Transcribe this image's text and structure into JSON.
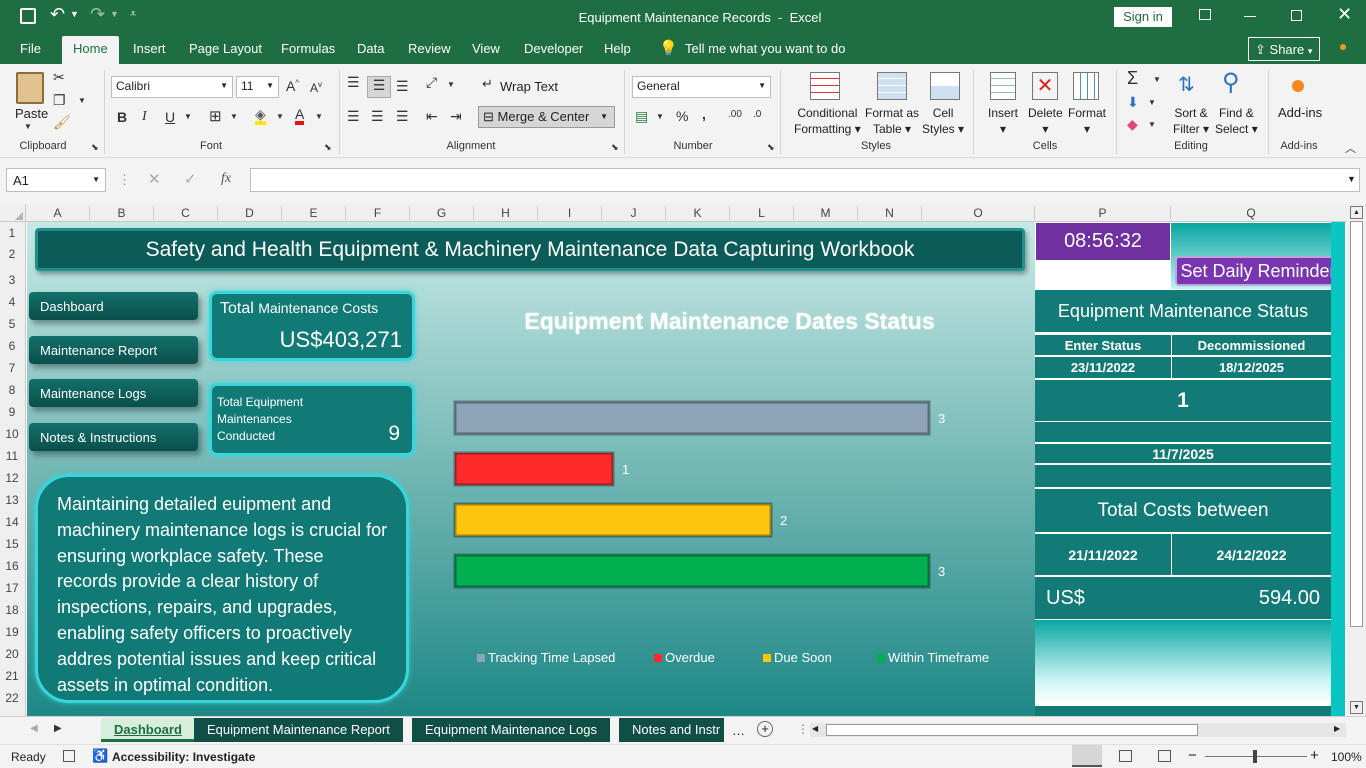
{
  "titlebar": {
    "doc_title": "Equipment Maintenance Records  -  Excel",
    "sign_in": "Sign in"
  },
  "menu": {
    "items": [
      "File",
      "Home",
      "Insert",
      "Page Layout",
      "Formulas",
      "Data",
      "Review",
      "View",
      "Developer",
      "Help"
    ],
    "tell_me": "Tell me what you want to do",
    "share": "Share"
  },
  "ribbon": {
    "clipboard": {
      "paste": "Paste",
      "label": "Clipboard"
    },
    "font": {
      "name": "Calibri",
      "size": "11",
      "label": "Font"
    },
    "alignment": {
      "wrap": "Wrap Text",
      "merge": "Merge & Center",
      "label": "Alignment"
    },
    "number": {
      "format": "General",
      "label": "Number"
    },
    "styles": {
      "cond1": "Conditional",
      "cond2": "Formatting",
      "fmt1": "Format as",
      "fmt2": "Table",
      "cell1": "Cell",
      "cell2": "Styles",
      "label": "Styles"
    },
    "cells": {
      "insert": "Insert",
      "delete": "Delete",
      "format": "Format",
      "label": "Cells"
    },
    "editing": {
      "sort1": "Sort &",
      "sort2": "Filter",
      "find1": "Find &",
      "find2": "Select",
      "label": "Editing"
    },
    "addins": {
      "btn": "Add-ins",
      "label": "Add-ins"
    }
  },
  "formula_bar": {
    "name_box": "A1",
    "fx": "fx",
    "formula": ""
  },
  "columns": [
    "A",
    "B",
    "C",
    "D",
    "E",
    "F",
    "G",
    "H",
    "I",
    "J",
    "K",
    "L",
    "M",
    "N",
    "O",
    "P",
    "Q"
  ],
  "rows": [
    "1",
    "2",
    "3",
    "4",
    "5",
    "6",
    "7",
    "8",
    "9",
    "10",
    "11",
    "12",
    "13",
    "14",
    "15",
    "16",
    "17",
    "18",
    "19",
    "20",
    "21",
    "22"
  ],
  "dashboard": {
    "banner": "Safety and Health Equipment & Machinery Maintenance Data Capturing Workbook",
    "nav": [
      "Dashboard",
      "Maintenance Report",
      "Maintenance Logs",
      "Notes & Instructions"
    ],
    "total_costs_label": "Total",
    "total_costs_label2": "Maintenance Costs",
    "total_costs_value": "US$403,271",
    "equip_label1": "Total Equipment",
    "equip_label2": "Maintenances",
    "equip_label3": "Conducted",
    "equip_value": "9",
    "note": "Maintaining detailed euipment and machinery maintenance logs is crucial for ensuring workplace safety. These records provide a clear history of inspections, repairs, and upgrades, enabling safety officers to proactively addres potential issues and keep critical assets in optimal condition."
  },
  "chart_data": {
    "type": "bar",
    "title": "Equipment Maintenance Dates Status",
    "categories": [
      "Tracking Time Lapsed",
      "Overdue",
      "Due Soon",
      "Within Timeframe"
    ],
    "values": [
      3,
      1,
      2,
      3
    ],
    "colors": [
      "#8da3b8",
      "#ff2a2a",
      "#ffc50c",
      "#00b050"
    ],
    "data_labels": [
      "3",
      "1",
      "2",
      "3"
    ],
    "xlim": [
      0,
      3
    ],
    "legend": "bottom",
    "grid": false
  },
  "panel": {
    "clock": "08:56:32",
    "reminder": "Set Daily Reminder",
    "status_title": "Equipment Maintenance Status",
    "hdr1": "Enter Status",
    "hdr2": "Decommissioned",
    "date1": "23/11/2022",
    "date2": "18/12/2025",
    "count": "1",
    "date3": "11/7/2025",
    "costs_title": "Total Costs between",
    "from": "21/11/2022",
    "to": "24/12/2022",
    "currency": "US$",
    "amount": "594.00"
  },
  "sheet_tabs": [
    "Dashboard",
    "Equipment Maintenance Report",
    "Equipment Maintenance Logs",
    "Notes and Instr"
  ],
  "status": {
    "ready": "Ready",
    "accessibility": "Accessibility: Investigate",
    "zoom": "100%"
  }
}
